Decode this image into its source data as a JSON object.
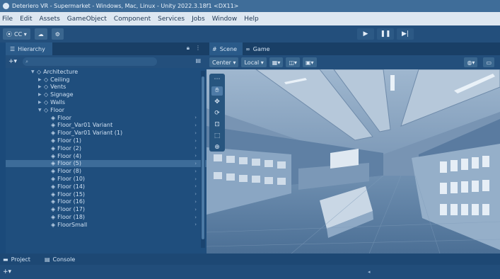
{
  "window": {
    "title": "Deteriero VR - Supermarket - Windows, Mac, Linux - Unity 2022.3.18f1 <DX11>"
  },
  "menu": [
    "File",
    "Edit",
    "Assets",
    "GameObject",
    "Component",
    "Services",
    "Jobs",
    "Window",
    "Help"
  ],
  "toolbar": {
    "account_label": "CC ▾",
    "cloud_icon": "cloud-icon",
    "settings_icon": "gear-icon",
    "play": "▶",
    "pause": "❚❚",
    "step": "▶|"
  },
  "hierarchy": {
    "tab_label": "Hierarchy",
    "search_placeholder": "",
    "items": [
      {
        "label": "Architecture",
        "depth": 0,
        "expanded": true,
        "kind": "group"
      },
      {
        "label": "Ceiling",
        "depth": 1,
        "expanded": false,
        "kind": "group"
      },
      {
        "label": "Vents",
        "depth": 1,
        "expanded": false,
        "kind": "group"
      },
      {
        "label": "Signage",
        "depth": 1,
        "expanded": false,
        "kind": "group"
      },
      {
        "label": "Walls",
        "depth": 1,
        "expanded": false,
        "kind": "group"
      },
      {
        "label": "Floor",
        "depth": 1,
        "expanded": true,
        "kind": "group"
      },
      {
        "label": "Floor",
        "depth": 2,
        "kind": "prefab"
      },
      {
        "label": "Floor_Var01 Variant",
        "depth": 2,
        "kind": "prefab"
      },
      {
        "label": "Floor_Var01 Variant (1)",
        "depth": 2,
        "kind": "prefab"
      },
      {
        "label": "Floor (1)",
        "depth": 2,
        "kind": "prefab"
      },
      {
        "label": "Floor (2)",
        "depth": 2,
        "kind": "prefab"
      },
      {
        "label": "Floor (4)",
        "depth": 2,
        "kind": "prefab"
      },
      {
        "label": "Floor (5)",
        "depth": 2,
        "kind": "prefab",
        "selected": true
      },
      {
        "label": "Floor (8)",
        "depth": 2,
        "kind": "prefab"
      },
      {
        "label": "Floor (10)",
        "depth": 2,
        "kind": "prefab"
      },
      {
        "label": "Floor (14)",
        "depth": 2,
        "kind": "prefab"
      },
      {
        "label": "Floor (15)",
        "depth": 2,
        "kind": "prefab"
      },
      {
        "label": "Floor (16)",
        "depth": 2,
        "kind": "prefab"
      },
      {
        "label": "Floor (17)",
        "depth": 2,
        "kind": "prefab"
      },
      {
        "label": "Floor (18)",
        "depth": 2,
        "kind": "prefab"
      },
      {
        "label": "FloorSmall",
        "depth": 2,
        "kind": "prefab"
      }
    ]
  },
  "scene": {
    "tabs": [
      {
        "label": "Scene",
        "active": true
      },
      {
        "label": "Game",
        "active": false
      }
    ],
    "toolbar": {
      "pivot_label": "Center ▾",
      "space_label": "Local ▾"
    }
  },
  "bottom": {
    "tabs": [
      {
        "label": "Project",
        "icon": "folder-icon"
      },
      {
        "label": "Console",
        "icon": "console-icon"
      }
    ]
  },
  "colors": {
    "tint": "#1b4a7a",
    "menubar": "#dde7f1",
    "selected_row": "#3d6c99"
  }
}
